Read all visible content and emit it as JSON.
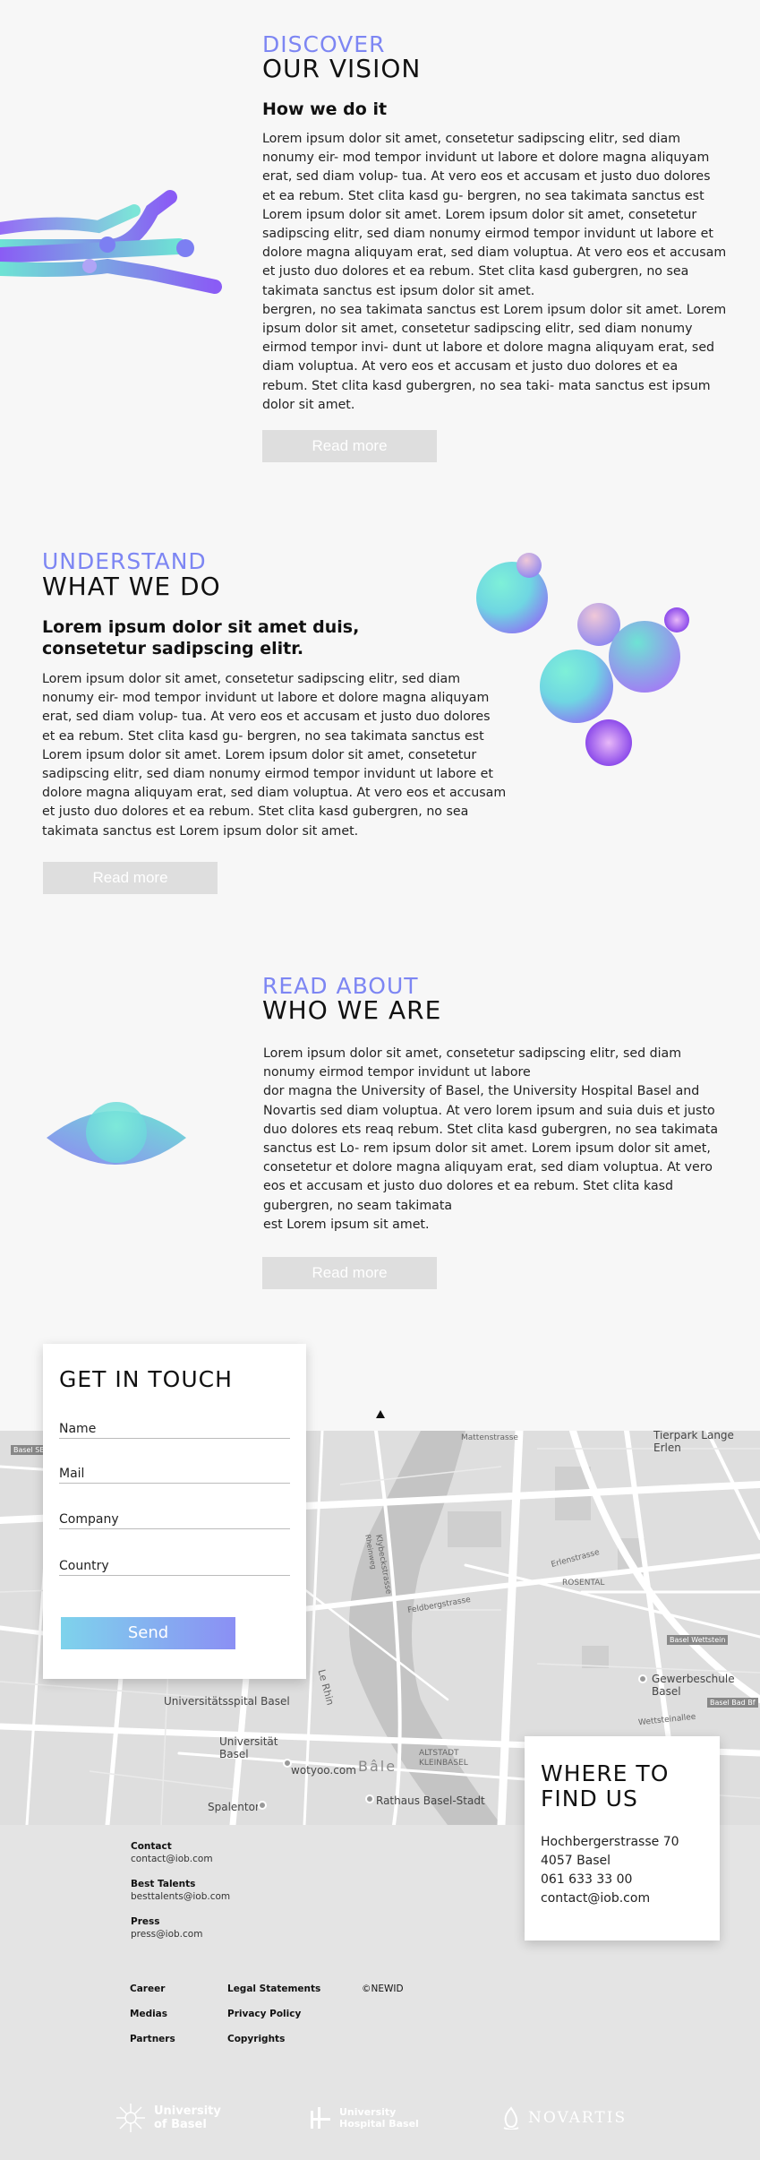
{
  "vision": {
    "eyebrow": "DISCOVER",
    "title": "OUR VISION",
    "subtitle": "How we do it",
    "body": "Lorem ipsum dolor sit amet, consetetur sadipscing elitr, sed diam\nnonumy eir- mod tempor invidunt ut labore et dolore magna aliquyam\nerat, sed diam volup- tua. At vero eos et accusam et justo duo dolores\net ea rebum. Stet clita kasd gu- bergren, no sea takimata sanctus est\nLorem ipsum dolor sit amet. Lorem ipsum dolor sit amet, consetetur\nsadipscing elitr, sed diam nonumy eirmod tempor invidunt ut labore et\ndolore magna aliquyam erat, sed diam voluptua. At vero eos et accusam\net justo duo dolores et ea rebum. Stet clita kasd gubergren, no sea\ntakimata sanctus est ipsum dolor sit amet.\nbergren, no sea takimata sanctus est Lorem ipsum dolor sit amet. Lorem\nipsum dolor sit amet, consetetur sadipscing elitr, sed diam nonumy\neirmod tempor invi- dunt ut labore et dolore magna aliquyam erat, sed\ndiam voluptua. At vero eos et accusam et justo duo dolores et ea\nrebum. Stet clita kasd gubergren, no sea taki- mata sanctus est ipsum\ndolor sit amet.",
    "button": "Read more"
  },
  "understand": {
    "eyebrow": "UNDERSTAND",
    "title": "WHAT WE DO",
    "subtitle": "Lorem ipsum dolor sit amet duis,\nconsetetur sadipscing elitr.",
    "body": "Lorem ipsum dolor sit amet, consetetur sadipscing elitr, sed diam\nnonumy eir- mod tempor invidunt ut labore et dolore magna aliquyam\nerat, sed diam volup- tua. At vero eos et accusam et justo duo dolores\net ea rebum. Stet clita kasd gu- bergren, no sea takimata sanctus est\nLorem ipsum dolor sit amet. Lorem ipsum dolor sit amet, consetetur\nsadipscing elitr, sed diam nonumy eirmod tempor invidunt ut labore et\ndolore magna aliquyam erat, sed diam voluptua. At vero eos et accusam\net justo duo dolores et ea rebum. Stet clita kasd gubergren, no sea\ntakimata sanctus est Lorem ipsum dolor sit amet.",
    "button": "Read more"
  },
  "about": {
    "eyebrow": "READ ABOUT",
    "title": "WHO WE ARE",
    "body": "Lorem ipsum dolor sit amet, consetetur sadipscing elitr, sed diam\nnonumy eirmod tempor invidunt ut labore\ndor magna the University of Basel, the University Hospital Basel and\nNovartis sed diam voluptua. At vero lorem ipsum and suia duis et justo\nduo dolores ets reaq rebum. Stet clita kasd gubergren, no sea takimata\nsanctus est Lo- rem ipsum dolor sit amet. Lorem ipsum dolor sit amet,\nconsetetur et dolore magna aliquyam erat, sed diam voluptua. At vero\neos et accusam et justo duo dolores et ea rebum. Stet clita kasd\ngubergren, no seam takimata\nest Lorem ipsum sit amet.",
    "button": "Read more"
  },
  "contact": {
    "title": "GET IN TOUCH",
    "fields": [
      "Name",
      "Mail",
      "Company",
      "Country"
    ],
    "send": "Send"
  },
  "map": {
    "labels": [
      "Universitätsspital Basel",
      "Universität Basel",
      "wotyoo.com",
      "Bâle",
      "Spalentor",
      "Rathaus Basel-Stadt",
      "ALTSTADT KLEINBASEL",
      "ROSENTAL",
      "Gewerbeschule Basel",
      "Basel Wettstein",
      "Basel Bad Bf",
      "Tierpark Lange Erlen",
      "Mattenstrasse",
      "Klybeckstrasse",
      "Feldbergstrasse",
      "Rheinweg",
      "Le Rhin",
      "Erlenstrasse",
      "Wettsteinallee",
      "Basel SBB"
    ]
  },
  "find": {
    "title": "WHERE TO\nFIND US",
    "lines": [
      "Hochbergerstrasse 70",
      "4057 Basel",
      "061 633 33 00",
      "contact@iob.com"
    ]
  },
  "footer": {
    "contacts": [
      {
        "label": "Contact",
        "value": "contact@iob.com"
      },
      {
        "label": "Best Talents",
        "value": "besttalents@iob.com"
      },
      {
        "label": "Press",
        "value": "press@iob.com"
      }
    ],
    "col1": [
      "Career",
      "Medias",
      "Partners"
    ],
    "col2": [
      "Legal Statements",
      "Privacy Policy",
      "Copyrights"
    ],
    "copyright": "©NEWID",
    "logos": [
      "University of Basel",
      "University Hospital Basel",
      "NOVARTIS"
    ]
  },
  "colors": {
    "accent": "#7d86f3",
    "teal": "#6ee3d4",
    "purple": "#8a5cf5"
  }
}
